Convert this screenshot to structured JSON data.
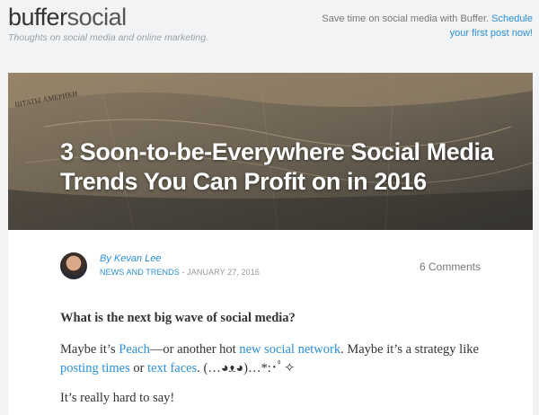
{
  "header": {
    "logo_part1": "buffer",
    "logo_part2": "social",
    "tagline": "Thoughts on social media and online marketing.",
    "promo_text": "Save time on social media with Buffer.",
    "promo_link": "Schedule your first post now!"
  },
  "article": {
    "title": "3 Soon-to-be-Everywhere Social Media Trends You Can Profit on in 2016",
    "hero_map_label": "ШТАТЫ АМЕРИКИ",
    "author_prefix": "By",
    "author": "Kevan Lee",
    "category": "NEWS AND TRENDS",
    "date": "- JANUARY 27, 2016",
    "comments": "6 Comments",
    "body": {
      "question": "What is the next big wave of social media?",
      "p2_a": "Maybe it’s ",
      "p2_link1": "Peach",
      "p2_b": "—or another hot ",
      "p2_link2": "new social network",
      "p2_c": ". Maybe it’s a strategy like ",
      "p2_link3": "posting times",
      "p2_d": " or ",
      "p2_link4": "text faces",
      "p2_e": ". (…◕ᴥ◕)…*:･ﾟ✧",
      "p3": "It’s really hard to say!"
    }
  },
  "colors": {
    "accent": "#2b8fd8",
    "page_bg": "#f2f3f4",
    "text": "#333333"
  }
}
